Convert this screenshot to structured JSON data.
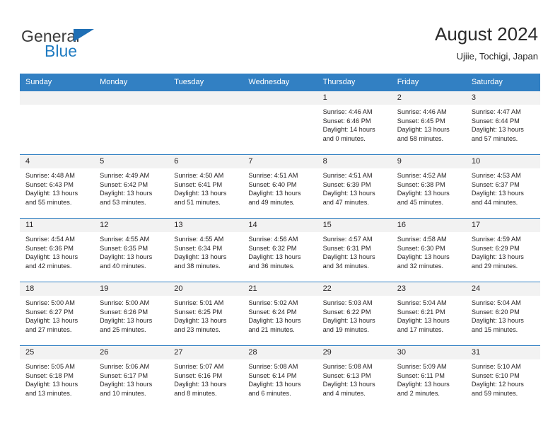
{
  "brand": {
    "name_part1": "General",
    "name_part2": "Blue",
    "triangle_color": "#1f6fb5",
    "blue_color": "#1f7bc1"
  },
  "header": {
    "title": "August 2024",
    "subtitle": "Ujiie, Tochigi, Japan",
    "header_bg_color": "#3280c3",
    "header_text_color": "#ffffff"
  },
  "weekdays": [
    "Sunday",
    "Monday",
    "Tuesday",
    "Wednesday",
    "Thursday",
    "Friday",
    "Saturday"
  ],
  "labels": {
    "sunrise_prefix": "Sunrise:",
    "sunset_prefix": "Sunset:",
    "daylight_prefix": "Daylight:"
  },
  "weeks": [
    [
      {
        "day": "",
        "blank": true
      },
      {
        "day": "",
        "blank": true
      },
      {
        "day": "",
        "blank": true
      },
      {
        "day": "",
        "blank": true
      },
      {
        "day": "1",
        "sunrise": "Sunrise: 4:46 AM",
        "sunset": "Sunset: 6:46 PM",
        "daylight1": "Daylight: 14 hours",
        "daylight2": "and 0 minutes."
      },
      {
        "day": "2",
        "sunrise": "Sunrise: 4:46 AM",
        "sunset": "Sunset: 6:45 PM",
        "daylight1": "Daylight: 13 hours",
        "daylight2": "and 58 minutes."
      },
      {
        "day": "3",
        "sunrise": "Sunrise: 4:47 AM",
        "sunset": "Sunset: 6:44 PM",
        "daylight1": "Daylight: 13 hours",
        "daylight2": "and 57 minutes."
      }
    ],
    [
      {
        "day": "4",
        "sunrise": "Sunrise: 4:48 AM",
        "sunset": "Sunset: 6:43 PM",
        "daylight1": "Daylight: 13 hours",
        "daylight2": "and 55 minutes."
      },
      {
        "day": "5",
        "sunrise": "Sunrise: 4:49 AM",
        "sunset": "Sunset: 6:42 PM",
        "daylight1": "Daylight: 13 hours",
        "daylight2": "and 53 minutes."
      },
      {
        "day": "6",
        "sunrise": "Sunrise: 4:50 AM",
        "sunset": "Sunset: 6:41 PM",
        "daylight1": "Daylight: 13 hours",
        "daylight2": "and 51 minutes."
      },
      {
        "day": "7",
        "sunrise": "Sunrise: 4:51 AM",
        "sunset": "Sunset: 6:40 PM",
        "daylight1": "Daylight: 13 hours",
        "daylight2": "and 49 minutes."
      },
      {
        "day": "8",
        "sunrise": "Sunrise: 4:51 AM",
        "sunset": "Sunset: 6:39 PM",
        "daylight1": "Daylight: 13 hours",
        "daylight2": "and 47 minutes."
      },
      {
        "day": "9",
        "sunrise": "Sunrise: 4:52 AM",
        "sunset": "Sunset: 6:38 PM",
        "daylight1": "Daylight: 13 hours",
        "daylight2": "and 45 minutes."
      },
      {
        "day": "10",
        "sunrise": "Sunrise: 4:53 AM",
        "sunset": "Sunset: 6:37 PM",
        "daylight1": "Daylight: 13 hours",
        "daylight2": "and 44 minutes."
      }
    ],
    [
      {
        "day": "11",
        "sunrise": "Sunrise: 4:54 AM",
        "sunset": "Sunset: 6:36 PM",
        "daylight1": "Daylight: 13 hours",
        "daylight2": "and 42 minutes."
      },
      {
        "day": "12",
        "sunrise": "Sunrise: 4:55 AM",
        "sunset": "Sunset: 6:35 PM",
        "daylight1": "Daylight: 13 hours",
        "daylight2": "and 40 minutes."
      },
      {
        "day": "13",
        "sunrise": "Sunrise: 4:55 AM",
        "sunset": "Sunset: 6:34 PM",
        "daylight1": "Daylight: 13 hours",
        "daylight2": "and 38 minutes."
      },
      {
        "day": "14",
        "sunrise": "Sunrise: 4:56 AM",
        "sunset": "Sunset: 6:32 PM",
        "daylight1": "Daylight: 13 hours",
        "daylight2": "and 36 minutes."
      },
      {
        "day": "15",
        "sunrise": "Sunrise: 4:57 AM",
        "sunset": "Sunset: 6:31 PM",
        "daylight1": "Daylight: 13 hours",
        "daylight2": "and 34 minutes."
      },
      {
        "day": "16",
        "sunrise": "Sunrise: 4:58 AM",
        "sunset": "Sunset: 6:30 PM",
        "daylight1": "Daylight: 13 hours",
        "daylight2": "and 32 minutes."
      },
      {
        "day": "17",
        "sunrise": "Sunrise: 4:59 AM",
        "sunset": "Sunset: 6:29 PM",
        "daylight1": "Daylight: 13 hours",
        "daylight2": "and 29 minutes."
      }
    ],
    [
      {
        "day": "18",
        "sunrise": "Sunrise: 5:00 AM",
        "sunset": "Sunset: 6:27 PM",
        "daylight1": "Daylight: 13 hours",
        "daylight2": "and 27 minutes."
      },
      {
        "day": "19",
        "sunrise": "Sunrise: 5:00 AM",
        "sunset": "Sunset: 6:26 PM",
        "daylight1": "Daylight: 13 hours",
        "daylight2": "and 25 minutes."
      },
      {
        "day": "20",
        "sunrise": "Sunrise: 5:01 AM",
        "sunset": "Sunset: 6:25 PM",
        "daylight1": "Daylight: 13 hours",
        "daylight2": "and 23 minutes."
      },
      {
        "day": "21",
        "sunrise": "Sunrise: 5:02 AM",
        "sunset": "Sunset: 6:24 PM",
        "daylight1": "Daylight: 13 hours",
        "daylight2": "and 21 minutes."
      },
      {
        "day": "22",
        "sunrise": "Sunrise: 5:03 AM",
        "sunset": "Sunset: 6:22 PM",
        "daylight1": "Daylight: 13 hours",
        "daylight2": "and 19 minutes."
      },
      {
        "day": "23",
        "sunrise": "Sunrise: 5:04 AM",
        "sunset": "Sunset: 6:21 PM",
        "daylight1": "Daylight: 13 hours",
        "daylight2": "and 17 minutes."
      },
      {
        "day": "24",
        "sunrise": "Sunrise: 5:04 AM",
        "sunset": "Sunset: 6:20 PM",
        "daylight1": "Daylight: 13 hours",
        "daylight2": "and 15 minutes."
      }
    ],
    [
      {
        "day": "25",
        "sunrise": "Sunrise: 5:05 AM",
        "sunset": "Sunset: 6:18 PM",
        "daylight1": "Daylight: 13 hours",
        "daylight2": "and 13 minutes."
      },
      {
        "day": "26",
        "sunrise": "Sunrise: 5:06 AM",
        "sunset": "Sunset: 6:17 PM",
        "daylight1": "Daylight: 13 hours",
        "daylight2": "and 10 minutes."
      },
      {
        "day": "27",
        "sunrise": "Sunrise: 5:07 AM",
        "sunset": "Sunset: 6:16 PM",
        "daylight1": "Daylight: 13 hours",
        "daylight2": "and 8 minutes."
      },
      {
        "day": "28",
        "sunrise": "Sunrise: 5:08 AM",
        "sunset": "Sunset: 6:14 PM",
        "daylight1": "Daylight: 13 hours",
        "daylight2": "and 6 minutes."
      },
      {
        "day": "29",
        "sunrise": "Sunrise: 5:08 AM",
        "sunset": "Sunset: 6:13 PM",
        "daylight1": "Daylight: 13 hours",
        "daylight2": "and 4 minutes."
      },
      {
        "day": "30",
        "sunrise": "Sunrise: 5:09 AM",
        "sunset": "Sunset: 6:11 PM",
        "daylight1": "Daylight: 13 hours",
        "daylight2": "and 2 minutes."
      },
      {
        "day": "31",
        "sunrise": "Sunrise: 5:10 AM",
        "sunset": "Sunset: 6:10 PM",
        "daylight1": "Daylight: 12 hours",
        "daylight2": "and 59 minutes."
      }
    ]
  ]
}
